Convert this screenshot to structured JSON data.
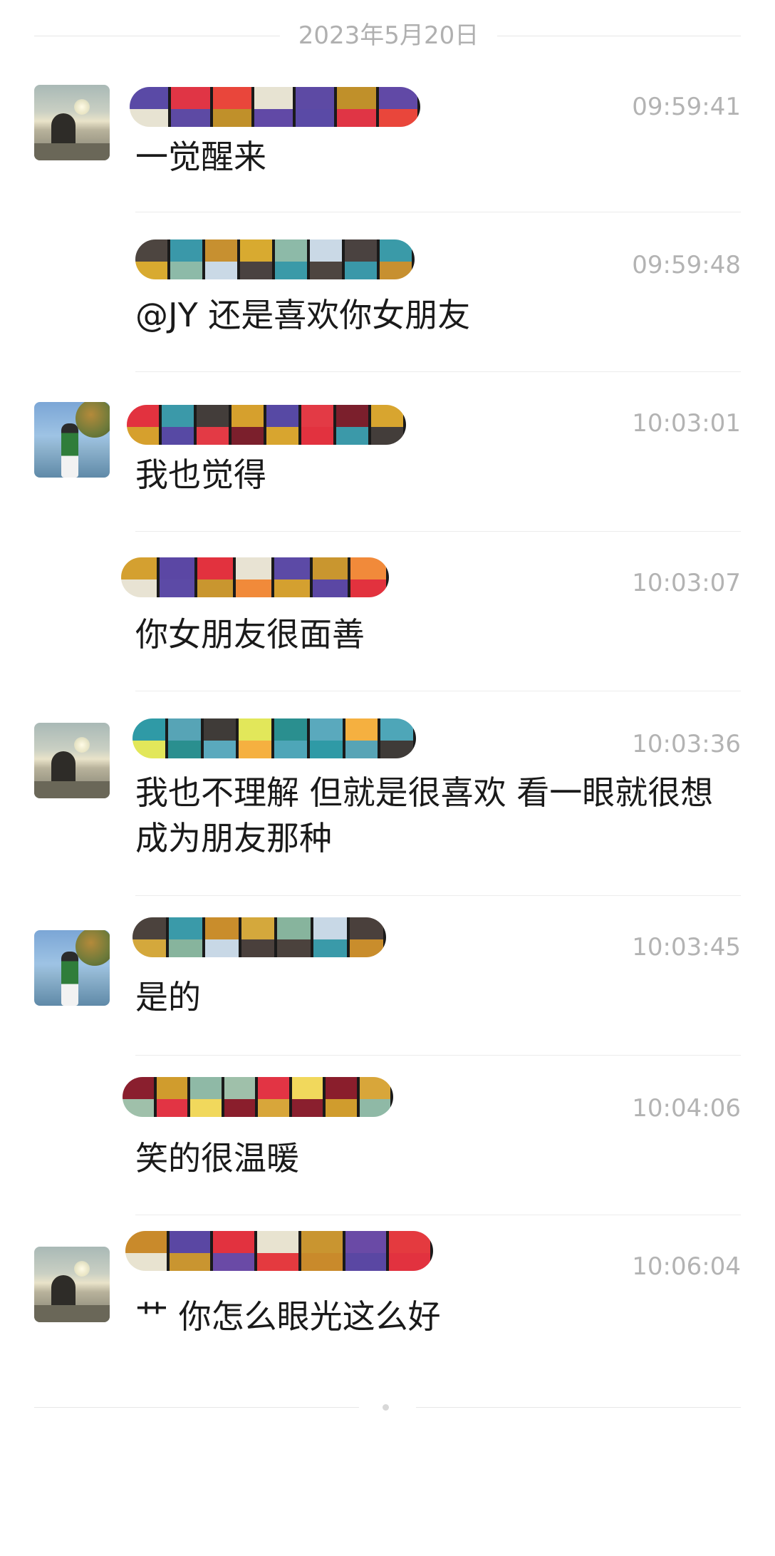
{
  "date_divider": "2023年5月20日",
  "messages": [
    {
      "avatar": "sunset-woman-avatar",
      "time": "09:59:41",
      "text": "一觉醒来",
      "name_colors": [
        "#5a4aa6",
        "#e03545",
        "#e9463b",
        "#e7e3d2",
        "#5d4aa4",
        "#c0902a",
        "#6149a6"
      ]
    },
    {
      "avatar": "",
      "time": "09:59:48",
      "text": "@JY 还是喜欢你女朋友",
      "name_colors": [
        "#4d4540",
        "#3a98a9",
        "#c79030",
        "#d8aa30",
        "#8dbaa8",
        "#cad9e6",
        "#4a4240",
        "#3a9aa8"
      ]
    },
    {
      "avatar": "lake-man-avatar",
      "time": "10:03:01",
      "text": "我也觉得",
      "name_colors": [
        "#e2323f",
        "#3b99a9",
        "#433d3a",
        "#d6a02d",
        "#5749a4",
        "#e33a45",
        "#7b1f2c",
        "#d8a52f"
      ]
    },
    {
      "avatar": "",
      "time": "10:03:07",
      "text": "你女朋友很面善",
      "name_colors": [
        "#d4a030",
        "#5b47a4",
        "#e2323e",
        "#e8e3d3",
        "#5c4aa6",
        "#c9962f",
        "#f18a3a"
      ]
    },
    {
      "avatar": "sunset-woman-avatar",
      "time": "10:03:36",
      "text": "我也不理解 但就是很喜欢 看一眼就很想成为朋友那种",
      "name_colors": [
        "#2f9aa6",
        "#57a4b6",
        "#3f3b38",
        "#e2e75a",
        "#2a8f8f",
        "#5aa9bd",
        "#f5b040",
        "#4ea6b8"
      ]
    },
    {
      "avatar": "lake-man-avatar",
      "time": "10:03:45",
      "text": "是的",
      "name_colors": [
        "#4b423d",
        "#3a9aa9",
        "#c98d2c",
        "#d4a83c",
        "#87b49d",
        "#c8d8e6",
        "#4a403c"
      ]
    },
    {
      "avatar": "",
      "time": "10:04:06",
      "text": "笑的很温暖",
      "name_colors": [
        "#8a1f2e",
        "#d09c2d",
        "#8fb9a6",
        "#9fc0aa",
        "#e23444",
        "#f1d85c",
        "#8a1e2c",
        "#d8a63a"
      ]
    },
    {
      "avatar": "sunset-woman-avatar",
      "time": "10:06:04",
      "text": "艹 你怎么眼光这么好",
      "name_colors": [
        "#c98a2b",
        "#5a47a3",
        "#e2323f",
        "#e8e3d0",
        "#c99530",
        "#6a4aa6",
        "#e43a3f"
      ]
    }
  ]
}
